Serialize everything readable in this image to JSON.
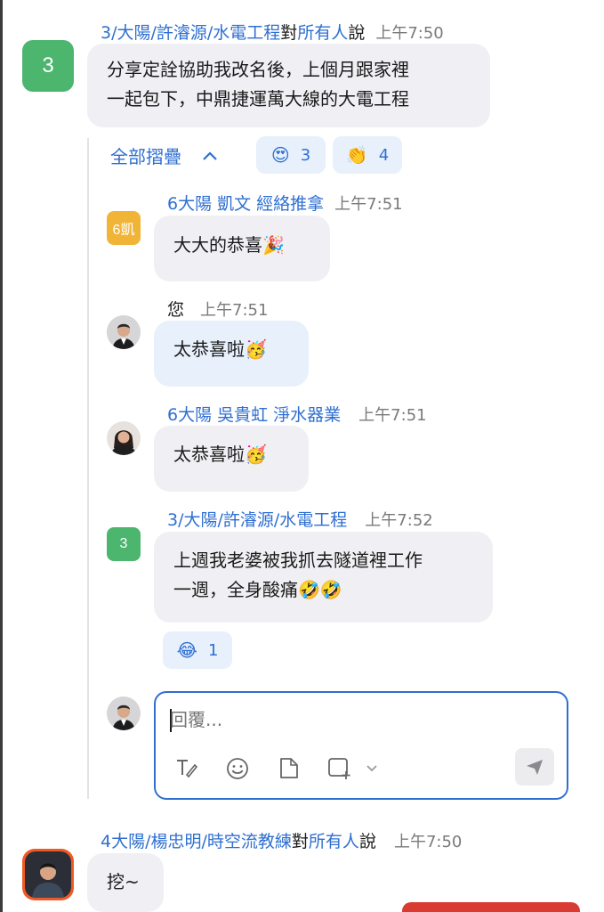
{
  "thread": {
    "parent": {
      "avatar": "3",
      "avatar_color": "#4cb56e",
      "sender": "3/大陽/許濬源/水電工程",
      "to_word": "對",
      "recipients": "所有人",
      "said": "說",
      "time": "上午7:50",
      "lines": [
        "分享定詮協助我改名後，上個月跟家裡",
        "一起包下，中鼎捷運萬大線的大電工程"
      ]
    },
    "collapse_label": "全部摺疊",
    "reactions": [
      {
        "emoji": "😍",
        "count": "3"
      },
      {
        "emoji": "👏",
        "count": "4"
      }
    ],
    "replies": [
      {
        "avatar": "6凱",
        "avatar_color": "#f0b437",
        "sender": "6大陽 凱文 經絡推拿",
        "time": "上午7:51",
        "text": "大大的恭喜🎉"
      },
      {
        "avatar_kind": "photo-man",
        "sender": "您",
        "time": "上午7:51",
        "text": "太恭喜啦🥳"
      },
      {
        "avatar_kind": "photo-woman",
        "sender": "6大陽 吳貴虹 淨水器業",
        "time": "上午7:51",
        "text": "太恭喜啦🥳"
      },
      {
        "avatar": "3",
        "avatar_color": "#4cb56e",
        "sender": "3/大陽/許濬源/水電工程",
        "time": "上午7:52",
        "lines": [
          "上週我老婆被我抓去隧道裡工作",
          "一週，全身酸痛🤣🤣"
        ],
        "reaction": {
          "emoji": "😂",
          "count": "1"
        }
      }
    ],
    "composer": {
      "placeholder": "回覆..."
    }
  },
  "next": {
    "sender": "4大陽/楊忠明/時空流教練",
    "to_word": "對",
    "recipients": "所有人",
    "said": "說",
    "time": "上午7:50",
    "text": "挖~"
  },
  "icons": [
    "format-text-icon",
    "emoji-icon",
    "file-icon",
    "screenshot-icon",
    "chevron-down-icon",
    "send-icon"
  ]
}
